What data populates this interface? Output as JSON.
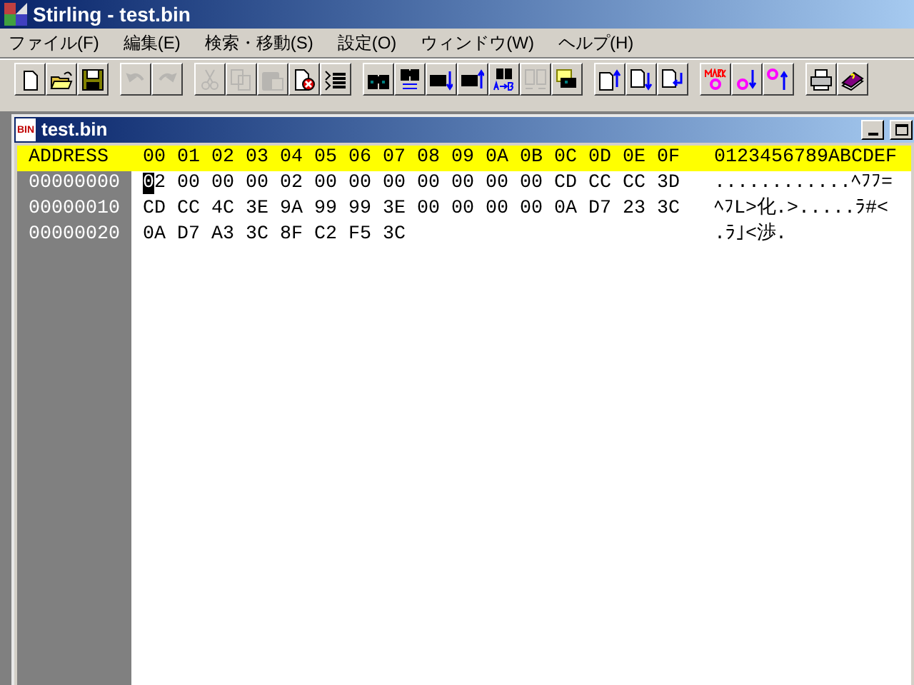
{
  "window": {
    "title": "Stirling - test.bin"
  },
  "menu": [
    "ファイル(F)",
    "編集(E)",
    "検索・移動(S)",
    "設定(O)",
    "ウィンドウ(W)",
    "ヘルプ(H)"
  ],
  "toolbar": [
    [
      {
        "kind": "new",
        "disabled": false
      },
      {
        "kind": "open",
        "disabled": false
      },
      {
        "kind": "save",
        "disabled": false
      }
    ],
    [
      {
        "kind": "undo",
        "disabled": true
      },
      {
        "kind": "redo",
        "disabled": true
      }
    ],
    [
      {
        "kind": "cut",
        "disabled": true
      },
      {
        "kind": "copy",
        "disabled": true
      },
      {
        "kind": "paste",
        "disabled": true
      },
      {
        "kind": "delete",
        "disabled": false
      },
      {
        "kind": "list",
        "disabled": false
      }
    ],
    [
      {
        "kind": "find",
        "disabled": false
      },
      {
        "kind": "findreplace",
        "disabled": false
      },
      {
        "kind": "finddown",
        "disabled": false
      },
      {
        "kind": "findup",
        "disabled": false
      },
      {
        "kind": "findab",
        "disabled": false
      },
      {
        "kind": "compare",
        "disabled": true
      },
      {
        "kind": "jump",
        "disabled": false
      }
    ],
    [
      {
        "kind": "pageup",
        "disabled": false
      },
      {
        "kind": "pagedown",
        "disabled": false
      },
      {
        "kind": "pageenter",
        "disabled": false
      }
    ],
    [
      {
        "kind": "mark",
        "disabled": false
      },
      {
        "kind": "markdown",
        "disabled": false
      },
      {
        "kind": "markup",
        "disabled": false
      }
    ],
    [
      {
        "kind": "print",
        "disabled": false
      },
      {
        "kind": "help",
        "disabled": false
      }
    ]
  ],
  "document": {
    "title": "test.bin",
    "icon_label": "BIN",
    "header": {
      "address": "ADDRESS",
      "columns": [
        "00",
        "01",
        "02",
        "03",
        "04",
        "05",
        "06",
        "07",
        "08",
        "09",
        "0A",
        "0B",
        "0C",
        "0D",
        "0E",
        "0F"
      ],
      "ascii": "0123456789ABCDEF"
    },
    "rows": [
      {
        "address": "00000000",
        "bytes": [
          "02",
          "00",
          "00",
          "00",
          "02",
          "00",
          "00",
          "00",
          "00",
          "00",
          "00",
          "00",
          "CD",
          "CC",
          "CC",
          "3D"
        ],
        "ascii": "............ﾍﾌﾌ=",
        "cursor": true
      },
      {
        "address": "00000010",
        "bytes": [
          "CD",
          "CC",
          "4C",
          "3E",
          "9A",
          "99",
          "99",
          "3E",
          "00",
          "00",
          "00",
          "00",
          "0A",
          "D7",
          "23",
          "3C"
        ],
        "ascii": "ﾍﾌL>化.>.....ﾗ#<",
        "cursor": false
      },
      {
        "address": "00000020",
        "bytes": [
          "0A",
          "D7",
          "A3",
          "3C",
          "8F",
          "C2",
          "F5",
          "3C"
        ],
        "ascii": ".ﾗ｣<渉.",
        "cursor": false
      }
    ]
  }
}
